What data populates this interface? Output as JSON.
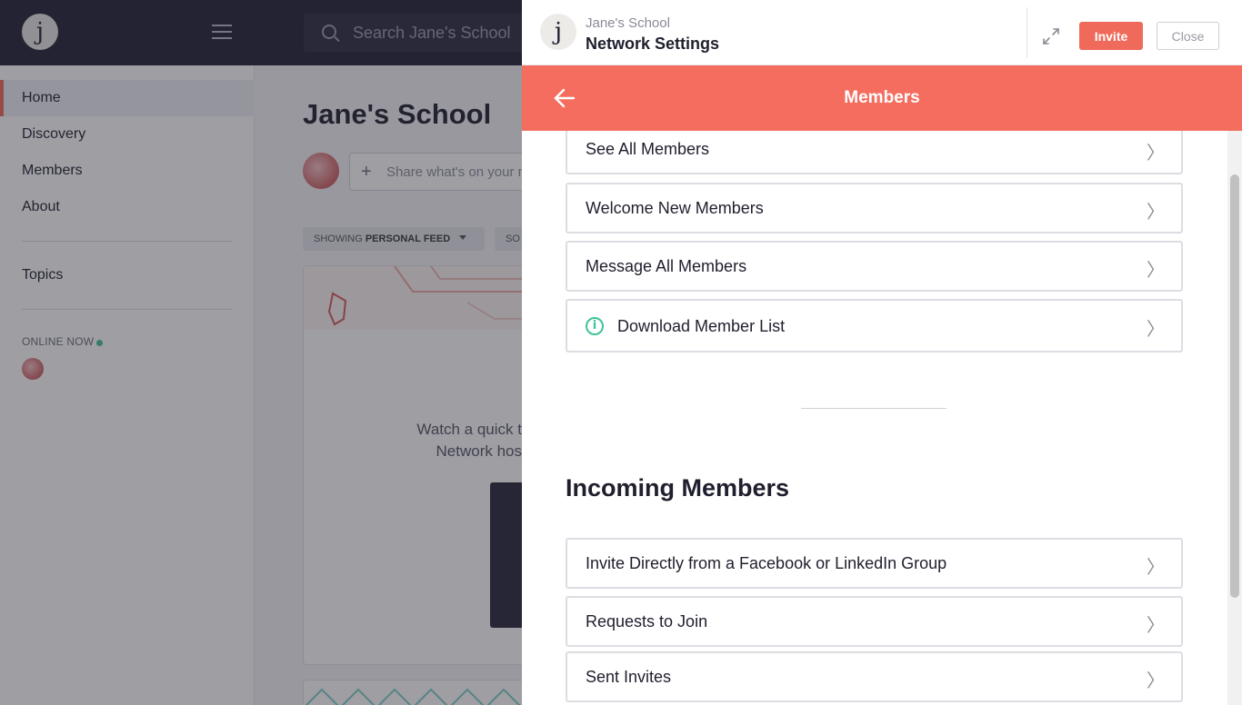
{
  "app": {
    "logo_letter": "j",
    "search_placeholder": "Search Jane's School",
    "sidebar": {
      "items": [
        {
          "label": "Home",
          "active": true
        },
        {
          "label": "Discovery"
        },
        {
          "label": "Members"
        },
        {
          "label": "About"
        }
      ],
      "topics_label": "Topics",
      "online_now_label": "ONLINE NOW"
    },
    "main": {
      "title": "Jane's School",
      "share_placeholder": "Share what's on your m",
      "filter_showing": "SHOWING ",
      "filter_feed": "PERSONAL FEED",
      "filter_sort": "SO",
      "feed_text_1": "Watch a quick t",
      "feed_text_2": "Network hos"
    }
  },
  "panel": {
    "logo_letter": "j",
    "network_name": "Jane's School",
    "title": "Network Settings",
    "invite_label": "Invite",
    "close_label": "Close",
    "section_title": "Members",
    "member_rows": [
      {
        "label": "See All Members"
      },
      {
        "label": "Welcome New Members"
      },
      {
        "label": "Message All Members"
      },
      {
        "label": "Download Member List",
        "icon": "info-icon"
      }
    ],
    "incoming_title": "Incoming Members",
    "incoming_rows": [
      {
        "label": "Invite Directly from a Facebook or LinkedIn Group"
      },
      {
        "label": "Requests to Join"
      },
      {
        "label": "Sent Invites"
      }
    ],
    "chevron": "〉",
    "info_glyph": "i"
  },
  "colors": {
    "accent": "#f56d5f",
    "topbar": "#1f1f33",
    "online": "#3ec29a"
  }
}
